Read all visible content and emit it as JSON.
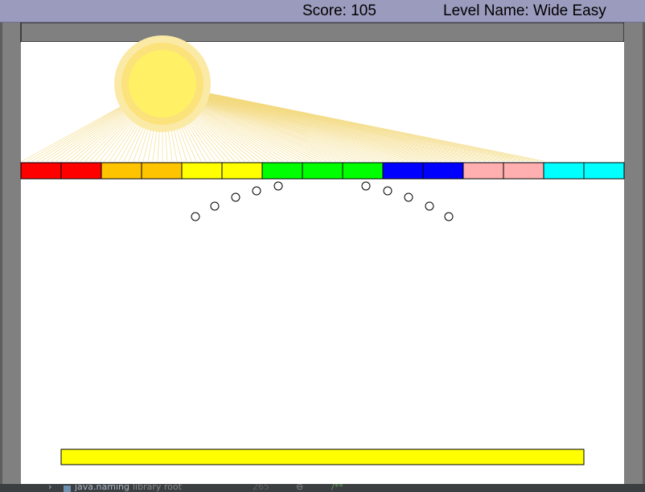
{
  "window": {
    "score_text": "Score: 105",
    "level_text": "Level Name: Wide Easy"
  },
  "game": {
    "background_color": "#ffffff",
    "border_color": "#808080",
    "sun_colors": {
      "outer": "#fbeaa6",
      "mid": "#fbe27a",
      "core": "#fff066",
      "rays": "#f3d97e"
    },
    "block_rows": [
      {
        "colors": [
          "#ff0000",
          "#ff0000",
          "#ffc400",
          "#ffc400",
          "#ffff00",
          "#ffff00",
          "#00ff00",
          "#00ff00",
          "#00ff00",
          "#0000ff",
          "#0000ff",
          "#ffafaf",
          "#ffafaf",
          "#00ffff",
          "#00ffff"
        ]
      }
    ],
    "balls_count": 10,
    "paddle_color": "#ffff00"
  },
  "ide_background": {
    "arrow": "›",
    "module_label": "java.naming",
    "root_label": "library root",
    "line_number": "265",
    "fold_marker": "⊖",
    "code_fragment": "/**"
  }
}
